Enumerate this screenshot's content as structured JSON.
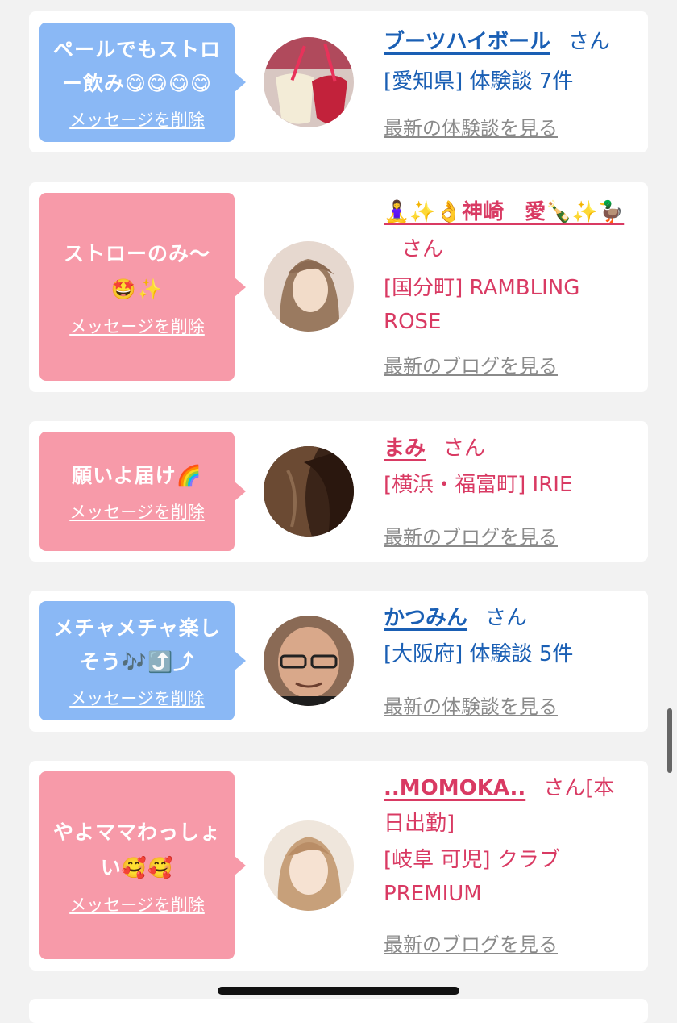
{
  "cards": [
    {
      "message": "ペールでもストロー飲み😋😋😋😋",
      "delete_label": "メッセージを削除",
      "name": "ブーツハイボール",
      "honorific": "さん",
      "line1": "[愛知県] 体験談 7件",
      "line2": "",
      "more_label": "最新の体験談を見る",
      "color_theme": "blue",
      "avatar_icon": "drinks-photo"
    },
    {
      "message": "ストローのみ〜🤩✨",
      "delete_label": "メッセージを削除",
      "name": "🧘‍♀️✨👌神崎　愛🍾✨🦆",
      "honorific": "さん",
      "line1": "[国分町] RAMBLING",
      "line2": "ROSE",
      "more_label": "最新のブログを見る",
      "color_theme": "pink",
      "avatar_icon": "woman-photo"
    },
    {
      "message": "願いよ届け🌈",
      "delete_label": "メッセージを削除",
      "name": "まみ",
      "honorific": "さん",
      "line1": "[横浜・福富町] IRIE",
      "line2": "",
      "more_label": "最新のブログを見る",
      "color_theme": "pink",
      "avatar_icon": "hair-photo"
    },
    {
      "message": "メチャメチャ楽しそう🎶⤴️⤴",
      "delete_label": "メッセージを削除",
      "name": "かつみん",
      "honorific": "さん",
      "line1": "[大阪府] 体験談 5件",
      "line2": "",
      "more_label": "最新の体験談を見る",
      "color_theme": "blue",
      "avatar_icon": "man-photo"
    },
    {
      "message": "やよママわっしょい🥰🥰",
      "delete_label": "メッセージを削除",
      "name": "..MOMOKA..",
      "honorific": "さん[本日出勤]",
      "line1": "[岐阜 可児] クラブ",
      "line2": "PREMIUM",
      "more_label": "最新のブログを見る",
      "color_theme": "pink",
      "avatar_icon": "woman-photo"
    }
  ],
  "colors": {
    "blue_bubble": "#8ab8f5",
    "pink_bubble": "#f79aa9",
    "blue_text": "#1a5fb4",
    "pink_text": "#d93a63"
  }
}
